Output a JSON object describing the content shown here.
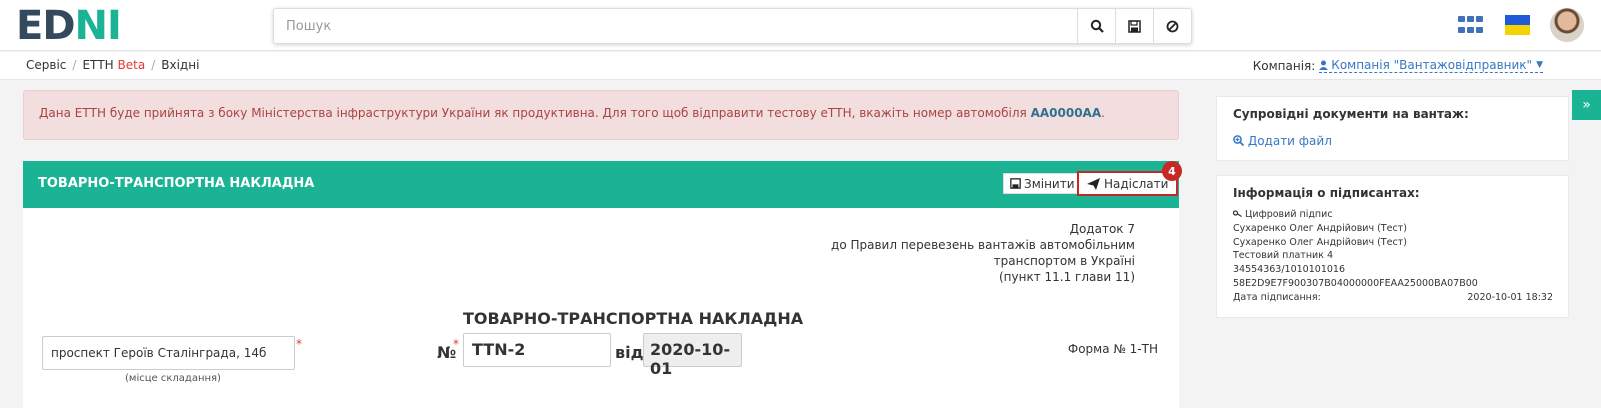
{
  "header": {
    "logo_ed": "ED",
    "logo_n": "N",
    "logo_i": "I",
    "search_placeholder": "Пошук",
    "icons": [
      "search-icon",
      "save-icon",
      "block-icon",
      "apps-grid-icon",
      "ukraine-flag-icon",
      "avatar"
    ]
  },
  "breadcrumb": {
    "items": [
      "Сервіс",
      "ЕТТН",
      "Вхідні"
    ],
    "beta": "Beta"
  },
  "company": {
    "label": "Компанія:",
    "value": "Компанія \"Вантажовідправник\""
  },
  "alert": {
    "text_before": "Дана ЕТТН буде прийнята з боку Міністерства інфраструктури України як продуктивна. Для того щоб відправити тестову еТТН, вкажіть номер автомобіля ",
    "plate": "АА0000АА",
    "text_after": "."
  },
  "panel": {
    "title": "ТОВАРНО-ТРАНСПОРТНА НАКЛАДНА",
    "edit_label": "Змінити",
    "send_label": "Надіслати",
    "step_badge": "4",
    "annex_lines": [
      "Додаток 7",
      "до Правил перевезень вантажів автомобільним",
      "транспортом в Україні",
      "(пункт 11.1 глави 11)"
    ],
    "doc_title": "ТОВАРНО-ТРАНСПОРТНА НАКЛАДНА",
    "place_value": "проспект Героїв Сталінграда, 14б",
    "place_caption": "(місце складання)",
    "no_label": "№",
    "no_value": "TTN-2",
    "date_label": "від",
    "date_value": "2020-10-01",
    "form_label": "Форма № 1-ТН",
    "required_mark": "*"
  },
  "side": {
    "docs_title": "Супровідні документи на вантаж:",
    "add_file": "Додати файл",
    "signers_title": "Інформація о підписантах:",
    "sign_type": "Цифровий підпис",
    "signer_1": "Сухаренко Олег Андрійович (Тест)",
    "signer_2": "Сухаренко Олег Андрійович (Тест)",
    "payer": "Тестовий платник 4",
    "codes": "34554363/1010101016",
    "serial": "58E2D9E7F900307B04000000FEAA25000BA07B00",
    "sign_date_label": "Дата підписання:",
    "sign_date_value": "2020-10-01 18:32",
    "toggle": "»"
  },
  "colors": {
    "accent": "#1ab394",
    "danger": "#c62828",
    "link": "#3778c2"
  }
}
